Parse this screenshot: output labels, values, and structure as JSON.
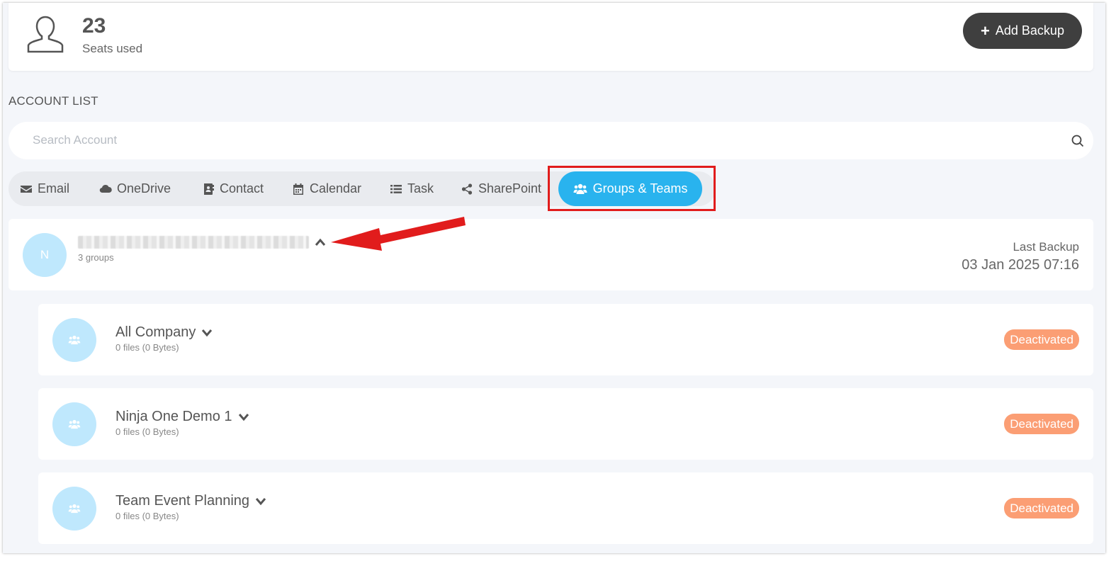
{
  "seats": {
    "count": "23",
    "label": "Seats used"
  },
  "add_backup": {
    "label": "Add Backup"
  },
  "account_list": {
    "title": "ACCOUNT LIST"
  },
  "search": {
    "placeholder": "Search Account"
  },
  "tabs": [
    {
      "label": "Email",
      "icon": "envelope-icon"
    },
    {
      "label": "OneDrive",
      "icon": "cloud-icon"
    },
    {
      "label": "Contact",
      "icon": "address-book-icon"
    },
    {
      "label": "Calendar",
      "icon": "calendar-icon"
    },
    {
      "label": "Task",
      "icon": "list-icon"
    },
    {
      "label": "SharePoint",
      "icon": "share-icon"
    },
    {
      "label": "Groups & Teams",
      "icon": "users-icon",
      "active": true
    }
  ],
  "account": {
    "initial": "N",
    "groups_count": "3 groups",
    "last_backup_label": "Last Backup",
    "last_backup_date": "03 Jan 2025 07:16"
  },
  "groups": [
    {
      "name": "All Company",
      "files": "0 files (0 Bytes)",
      "status": "Deactivated"
    },
    {
      "name": "Ninja One Demo 1",
      "files": "0 files (0 Bytes)",
      "status": "Deactivated"
    },
    {
      "name": "Team Event Planning",
      "files": "0 files (0 Bytes)",
      "status": "Deactivated"
    }
  ],
  "colors": {
    "active_tab": "#29b3ee",
    "avatar": "#bfe8fd",
    "badge": "#fb9e74",
    "annotation": "#e11c1c",
    "primary_button": "#3f3f3f"
  }
}
